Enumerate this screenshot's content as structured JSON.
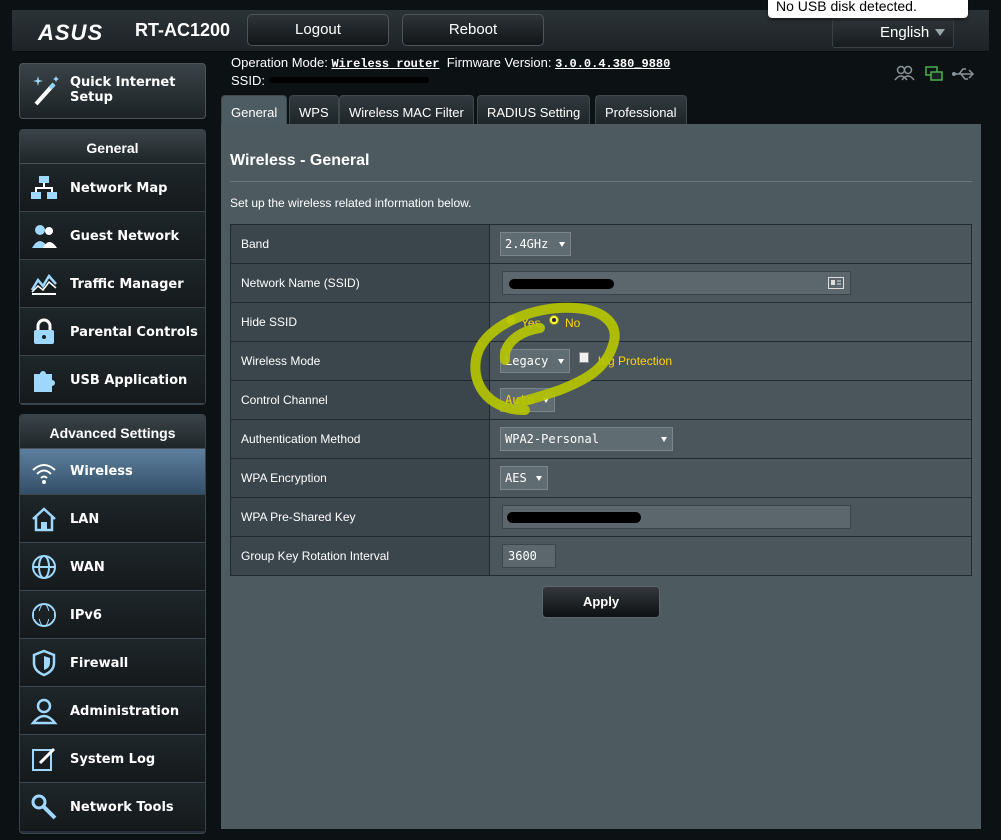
{
  "header": {
    "brand": "ASUS",
    "model": "RT-AC1200",
    "logout_label": "Logout",
    "reboot_label": "Reboot",
    "language": "English",
    "usb_notice": "No USB disk detected."
  },
  "status": {
    "operation_mode_label": "Operation Mode:",
    "operation_mode_value": "Wireless router",
    "firmware_label": "Firmware Version:",
    "firmware_value": "3.0.0.4.380_9880",
    "ssid_label": "SSID:",
    "icons": [
      "clients-icon",
      "network-status-icon",
      "usb-icon"
    ]
  },
  "sidebar": {
    "quick_setup_label": "Quick Internet Setup",
    "general_heading": "General",
    "general_items": [
      {
        "label": "Network Map",
        "icon": "network-map-icon"
      },
      {
        "label": "Guest Network",
        "icon": "guest-network-icon"
      },
      {
        "label": "Traffic Manager",
        "icon": "traffic-manager-icon"
      },
      {
        "label": "Parental Controls",
        "icon": "parental-controls-icon"
      },
      {
        "label": "USB Application",
        "icon": "usb-application-icon"
      }
    ],
    "advanced_heading": "Advanced Settings",
    "advanced_items": [
      {
        "label": "Wireless",
        "icon": "wireless-icon",
        "active": true
      },
      {
        "label": "LAN",
        "icon": "lan-icon"
      },
      {
        "label": "WAN",
        "icon": "wan-icon"
      },
      {
        "label": "IPv6",
        "icon": "ipv6-icon"
      },
      {
        "label": "Firewall",
        "icon": "firewall-icon"
      },
      {
        "label": "Administration",
        "icon": "administration-icon"
      },
      {
        "label": "System Log",
        "icon": "system-log-icon"
      },
      {
        "label": "Network Tools",
        "icon": "network-tools-icon"
      }
    ]
  },
  "tabs": [
    {
      "label": "General",
      "active": true
    },
    {
      "label": "WPS"
    },
    {
      "label": "Wireless MAC Filter"
    },
    {
      "label": "RADIUS Setting"
    },
    {
      "label": "Professional"
    }
  ],
  "panel": {
    "title": "Wireless - General",
    "description": "Set up the wireless related information below.",
    "apply_label": "Apply",
    "fields": {
      "band": {
        "label": "Band",
        "value": "2.4GHz"
      },
      "ssid": {
        "label": "Network Name (SSID)"
      },
      "hide_ssid": {
        "label": "Hide SSID",
        "yes": "Yes",
        "no": "No",
        "selected": "No"
      },
      "wireless_mode": {
        "label": "Wireless Mode",
        "value": "Legacy",
        "bg_protection": "b/g Protection"
      },
      "control_channel": {
        "label": "Control Channel",
        "value": "Auto"
      },
      "auth_method": {
        "label": "Authentication Method",
        "value": "WPA2-Personal"
      },
      "wpa_encryption": {
        "label": "WPA Encryption",
        "value": "AES"
      },
      "psk": {
        "label": "WPA Pre-Shared Key"
      },
      "group_key": {
        "label": "Group Key Rotation Interval",
        "value": "3600"
      }
    }
  },
  "colors": {
    "highlight_yellow": "#ffd700",
    "annotation_green": "#b5c400"
  }
}
